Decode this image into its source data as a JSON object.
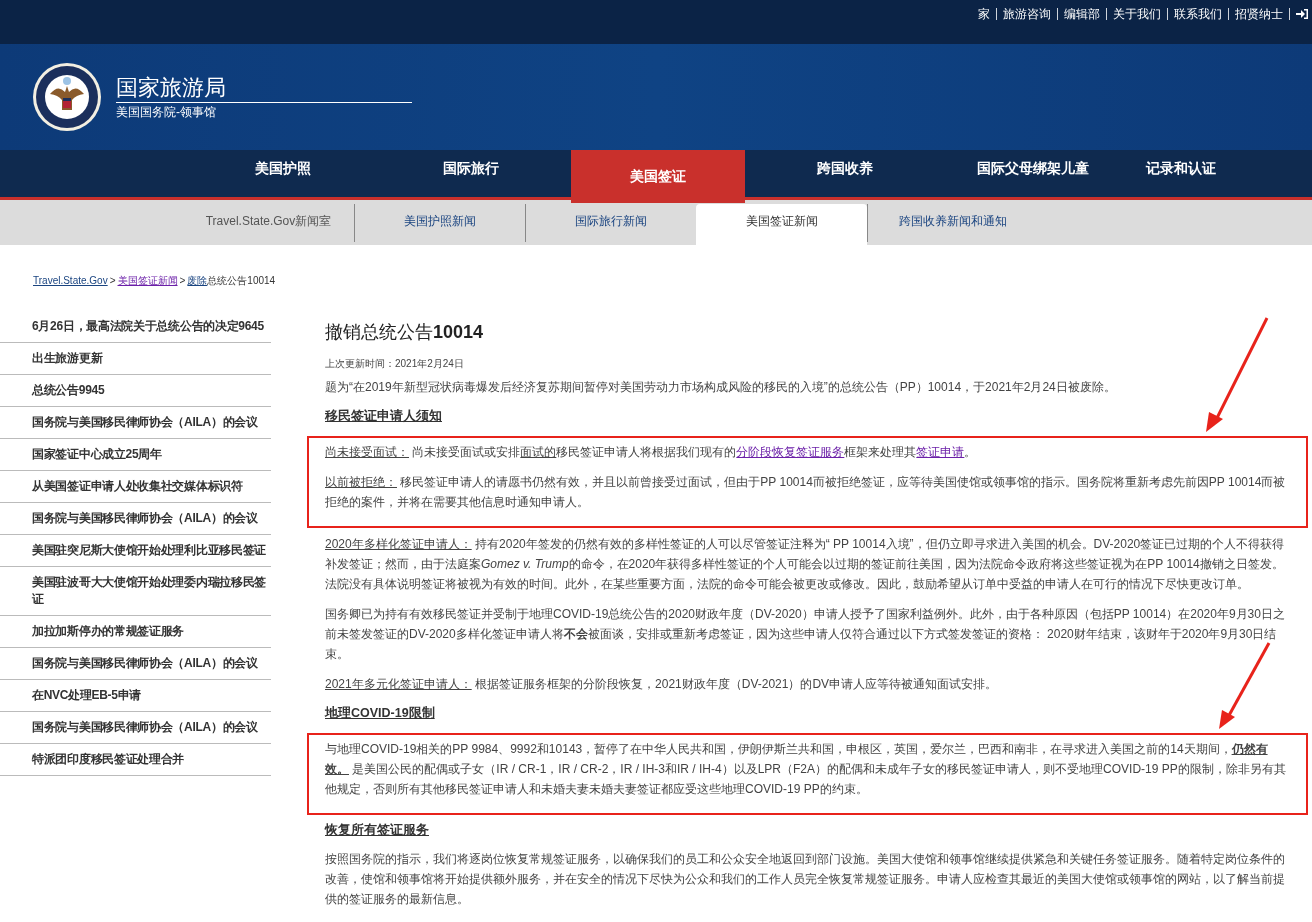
{
  "top_links": [
    "家",
    "旅游咨询",
    "编辑部",
    "关于我们",
    "联系我们",
    "招贤纳士"
  ],
  "header": {
    "title": "国家旅游局",
    "subtitle": "美国国务院-领事馆"
  },
  "main_nav": [
    {
      "label": "美国护照",
      "selected": false
    },
    {
      "label": "国际旅行",
      "selected": false
    },
    {
      "label": "美国签证",
      "selected": true
    },
    {
      "label": "跨国收养",
      "selected": false
    },
    {
      "label": "国际父母绑架儿童",
      "selected": false
    },
    {
      "label": "记录和认证",
      "selected": false
    }
  ],
  "sub_nav": [
    {
      "label": "Travel.State.Gov新闻室",
      "selected": false
    },
    {
      "label": "美国护照新闻",
      "selected": false
    },
    {
      "label": "国际旅行新闻",
      "selected": false
    },
    {
      "label": "美国签证新闻",
      "selected": true
    },
    {
      "label": "跨国收养新闻和通知",
      "selected": false
    }
  ],
  "breadcrumb": [
    {
      "text": "Travel.State.Gov",
      "kind": "link"
    },
    {
      "text": ">",
      "kind": "sep"
    },
    {
      "text": "美国签证新闻",
      "kind": "visited"
    },
    {
      "text": ">",
      "kind": "sep"
    },
    {
      "text": "废除",
      "kind": "link"
    },
    {
      "text": "总统公告10014",
      "kind": "text"
    }
  ],
  "sidebar": [
    "6月26日，最高法院关于总统公告的决定9645",
    "出生旅游更新",
    "总统公告9945",
    "国务院与美国移民律师协会（AILA）的会议",
    "国家签证中心成立25周年",
    "从美国签证申请人处收集社交媒体标识符",
    "国务院与美国移民律师协会（AILA）的会议",
    "美国驻突尼斯大使馆开始处理利比亚移民签证",
    "美国驻波哥大大使馆开始处理委内瑞拉移民签证",
    "加拉加斯停办的常规签证服务",
    "国务院与美国移民律师协会（AILA）的会议",
    "在NVC处理EB-5申请",
    "国务院与美国移民律师协会（AILA）的会议",
    "特派团印度移民签证处理合并"
  ],
  "article": {
    "title": "撤销总统公告**10014**",
    "updated": "上次更新时间：2021年2月24日",
    "blocks": [
      {
        "kind": "paragraph",
        "framed": false,
        "segments": [
          {
            "kind": "text",
            "text": "题为“在2019年新型冠状病毒爆发后经济复苏期间暂停对美国劳动力市场构成风险的移民的入境”的总统公告（PP）10014，于2021年2月24日被废除。"
          }
        ]
      },
      {
        "kind": "heading",
        "framed": false,
        "segments": [
          {
            "kind": "text",
            "text": "移民签证申请人须知"
          }
        ]
      },
      {
        "kind": "paragraph",
        "framed": true,
        "segments": [
          {
            "kind": "label",
            "text": "尚未接受面试："
          },
          {
            "kind": "text",
            "text": " 尚未接受面试或安排"
          },
          {
            "kind": "underline",
            "text": "面试的"
          },
          {
            "kind": "text",
            "text": "移民签证申请人将根据我们现有的"
          },
          {
            "kind": "link",
            "text": "分阶段恢复签证服务"
          },
          {
            "kind": "text",
            "text": "框架来处理其"
          },
          {
            "kind": "link",
            "text": "签证申请"
          },
          {
            "kind": "text",
            "text": "。"
          }
        ]
      },
      {
        "kind": "paragraph",
        "framed": true,
        "segments": [
          {
            "kind": "label",
            "text": "以前被拒绝："
          },
          {
            "kind": "text",
            "text": " 移民签证申请人的请愿书仍然有效，并且以前曾接受过面试，但由于PP 10014而被拒绝签证，应等待美国使馆或领事馆的指示。国务院将重新考虑先前因PP 10014而被拒绝的案件，并将在需要其他信息时通知申请人。"
          }
        ]
      },
      {
        "kind": "paragraph",
        "framed": false,
        "segments": [
          {
            "kind": "label",
            "text": "2020年多样化签证申请人："
          },
          {
            "kind": "text",
            "text": " 持有2020年签发的仍然有效的多样性签证的人可以尽管签证注释为“ PP 10014入境”，但仍立即寻求进入美国的机会。DV-2020签证已过期的个人不得获得补发签证；然而，由于法庭案"
          },
          {
            "kind": "italic",
            "text": "Gomez v. Trump"
          },
          {
            "kind": "text",
            "text": "的命令，在2020年获得多样性签证的个人可能会以过期的签证前往美国，因为法院命令政府将这些签证视为在PP 10014撤销之日签发。法院没有具体说明签证将被视为有效的时间。此外，在某些重要方面，法院的命令可能会被更改或修改。因此，鼓励希望从订单中受益的申请人在可行的情况下尽快更改订单。"
          }
        ]
      },
      {
        "kind": "paragraph",
        "framed": false,
        "segments": [
          {
            "kind": "text",
            "text": "国务卿已为持有有效移民签证并受制于地理COVID-19总统公告的2020财政年度（DV-2020）申请人授予了国家利益例外。此外，由于各种原因（包括PP 10014）在2020年9月30日之前未签发签证的DV-2020多样化签证申请人将**不会**被面谈，安排或重新考虑签证，因为这些申请人仅符合通过以下方式签发签证的资格： 2020财年结束，该财年于2020年9月30日结束。"
          }
        ]
      },
      {
        "kind": "paragraph",
        "framed": false,
        "segments": [
          {
            "kind": "label",
            "text": "2021年多元化签证申请人："
          },
          {
            "kind": "text",
            "text": " 根据签证服务框架的分阶段恢复，2021财政年度（DV-2021）的DV申请人应等待被通知面试安排。"
          }
        ]
      },
      {
        "kind": "heading",
        "framed": false,
        "segments": [
          {
            "kind": "text",
            "text": "地理COVID-19限制"
          }
        ]
      },
      {
        "kind": "paragraph",
        "framed": true,
        "segments": [
          {
            "kind": "text",
            "text": "与地理COVID-19相关的PP 9984、9992和10143，暂停了在中华人民共和国，伊朗伊斯兰共和国，申根区，英国，爱尔兰，巴西和南非，在寻求进入美国之前的14天期间，"
          },
          {
            "kind": "strong-label",
            "text": "仍然有效。"
          },
          {
            "kind": "text",
            "text": "  是美国公民的配偶或子女（IR / CR-1，IR / CR-2，IR / IH-3和IR / IH-4）以及LPR（F2A）的配偶和未成年子女的移民签证申请人，则不受地理COVID-19 PP的限制，除非另有其他规定，否则所有其他移民签证申请人和未婚夫妻未婚夫妻签证都应受这些地理COVID-19 PP的约束。"
          }
        ]
      },
      {
        "kind": "heading",
        "framed": false,
        "segments": [
          {
            "kind": "text",
            "text": "恢复所有签证服务"
          }
        ]
      },
      {
        "kind": "paragraph",
        "framed": false,
        "segments": [
          {
            "kind": "text",
            "text": "按照国务院的指示，我们将逐岗位恢复常规签证服务，以确保我们的员工和公众安全地返回到部门设施。美国大使馆和领事馆继续提供紧急和关键任务签证服务。随着特定岗位条件的改善，使馆和领事馆将开始提供额外服务，并在安全的情况下尽快为公众和我们的工作人员完全恢复常规签证服务。申请人应检查其最近的美国大使馆或领事馆的网站，以了解当前提供的签证服务的最新信息。"
          }
        ]
      }
    ]
  }
}
